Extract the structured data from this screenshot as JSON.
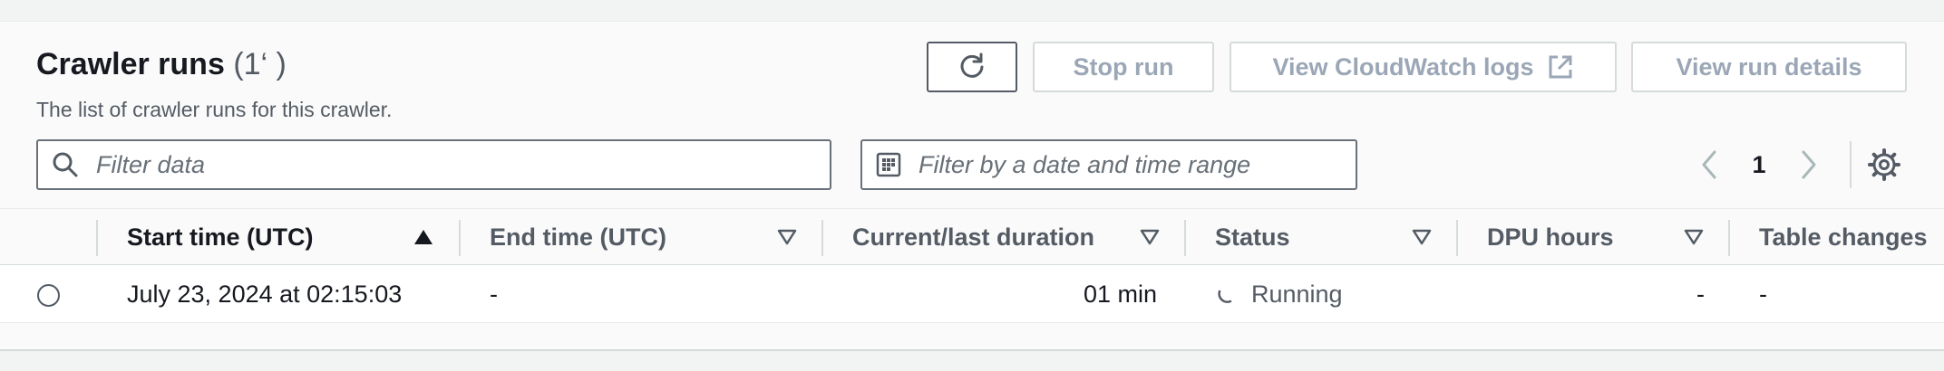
{
  "header": {
    "title": "Crawler runs",
    "count": "(1‘ )",
    "description": "The list of crawler runs for this crawler."
  },
  "actions": {
    "refresh_icon": "refresh-icon",
    "stop_run": "Stop run",
    "view_cloudwatch_logs": "View CloudWatch logs",
    "external_icon": "external-link-icon",
    "view_run_details": "View run details"
  },
  "filters": {
    "search_placeholder": "Filter data",
    "date_placeholder": "Filter by a date and time range"
  },
  "pagination": {
    "current_page": "1"
  },
  "table": {
    "columns": [
      {
        "label": "Start time (UTC)",
        "sort": "ascending"
      },
      {
        "label": "End time (UTC)",
        "sort": "none"
      },
      {
        "label": "Current/last duration",
        "sort": "none"
      },
      {
        "label": "Status",
        "sort": "none"
      },
      {
        "label": "DPU hours",
        "sort": "none"
      },
      {
        "label": "Table changes",
        "sort": "none"
      }
    ],
    "rows": [
      {
        "start_time": "July 23, 2024 at 02:15:03",
        "end_time": "-",
        "duration": "01 min",
        "status": "Running",
        "dpu_hours": "-",
        "table_changes": "-"
      }
    ]
  },
  "colors": {
    "text_primary": "#16191f",
    "text_secondary": "#545b64",
    "disabled": "#9ba7b6",
    "border": "#d5dbdb"
  }
}
